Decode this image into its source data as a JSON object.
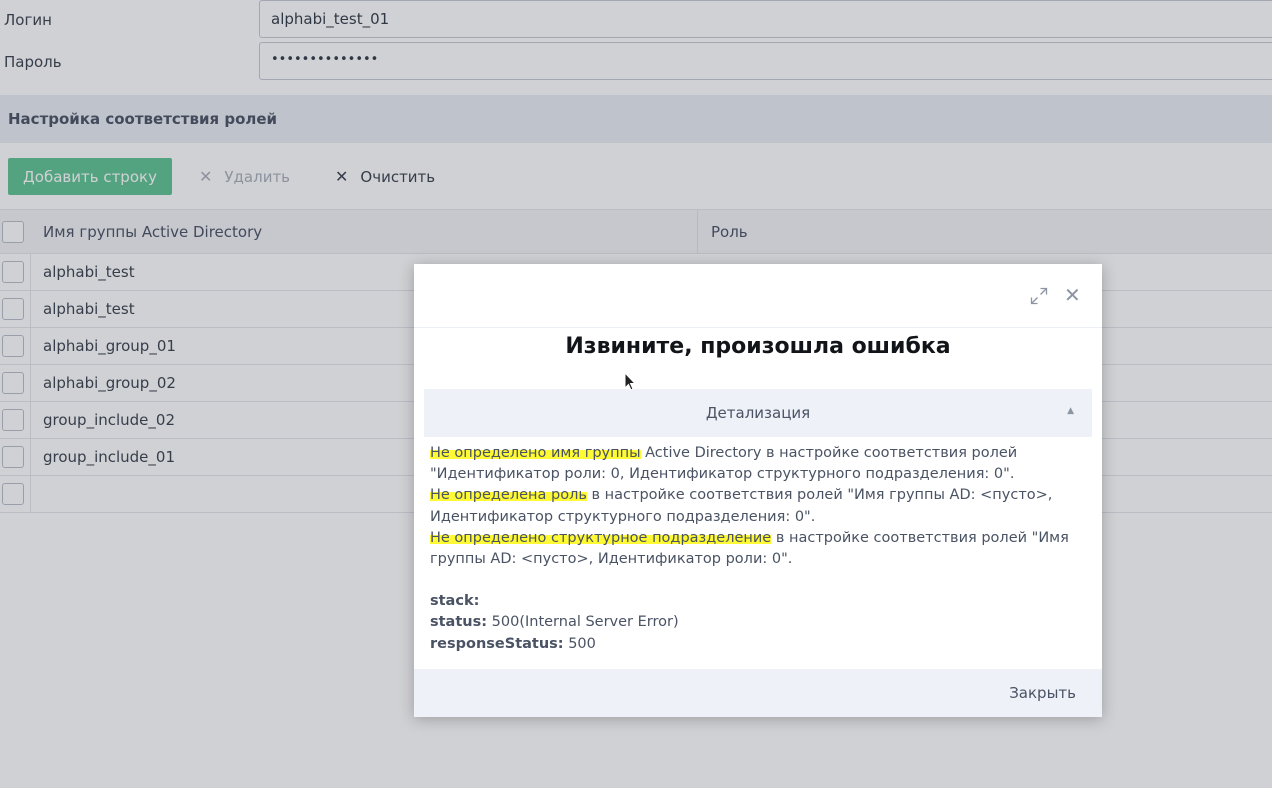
{
  "form": {
    "login_label": "Логин",
    "login_value": "alphabi_test_01",
    "password_label": "Пароль",
    "password_value": "••••••••••••••"
  },
  "section": {
    "title": "Настройка соответствия ролей"
  },
  "toolbar": {
    "add_label": "Добавить строку",
    "delete_label": "Удалить",
    "clear_label": "Очистить"
  },
  "grid": {
    "columns": [
      "Имя группы Active Directory",
      "Роль"
    ],
    "rows": [
      "alphabi_test",
      "alphabi_test",
      "alphabi_group_01",
      "alphabi_group_02",
      "group_include_02",
      "group_include_01",
      ""
    ]
  },
  "modal": {
    "title": "Извините, произошла ошибка",
    "details_label": "Детализация",
    "errors": [
      {
        "highlight": "Не определено имя группы",
        "rest": " Active Directory в настройке соответствия ролей \"Идентификатор роли: 0, Идентификатор структурного подразделения: 0\"."
      },
      {
        "highlight": "Не определена роль",
        "rest": " в настройке соответствия ролей \"Имя группы AD: <пусто>, Идентификатор структурного подразделения: 0\"."
      },
      {
        "highlight": "Не определено структурное подразделение",
        "rest": " в настройке соответствия ролей \"Имя группы AD: <пусто>, Идентификатор роли: 0\"."
      }
    ],
    "stack_key": "stack:",
    "status_key": "status:",
    "status_value": " 500(Internal Server Error)",
    "response_key": "responseStatus:",
    "response_value": " 500",
    "close_label": "Закрыть"
  },
  "colors": {
    "accent": "#5fc595",
    "highlight": "#fffa28"
  }
}
